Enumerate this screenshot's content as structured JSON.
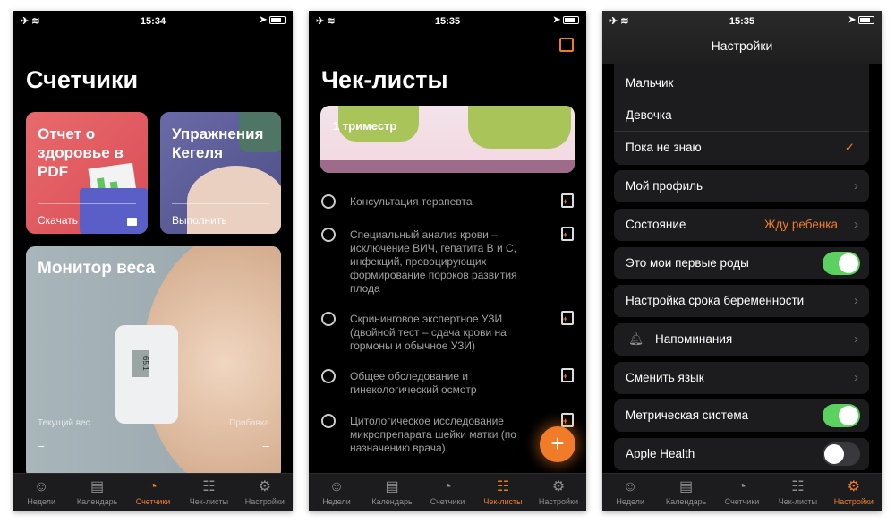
{
  "screens": [
    {
      "time": "15:34",
      "title": "Счетчики",
      "cards": {
        "pdf": {
          "title": "Отчет о здоровье в PDF",
          "action": "Скачать"
        },
        "kegel": {
          "title": "Упражнения Кегеля",
          "action": "Выполнить"
        },
        "weight": {
          "title": "Монитор веса",
          "current_label": "Текущий вес",
          "current_value": "–",
          "gain_label": "Прибавка",
          "gain_value": "–",
          "scale_reading": "65.1"
        }
      }
    },
    {
      "time": "15:35",
      "title": "Чек-листы",
      "banner": "1 триместр",
      "items": [
        "Консультация терапевта",
        "Специальный анализ крови – исключение ВИЧ, гепатита В и С, инфекций, провоцирующих формирование пороков развития плода",
        "Скрининговое экспертное УЗИ (двойной тест – сдача крови на гормоны и обычное УЗИ)",
        "Общее обследование и гинекологический осмотр",
        "Цитологическое исследование микропрепарата шейки матки (по назначению врача)"
      ],
      "fab": "+"
    },
    {
      "time": "15:35",
      "title": "Настройки",
      "gender_options": [
        "Мальчик",
        "Девочка",
        "Пока не знаю"
      ],
      "selected": "Пока не знаю",
      "rows": {
        "profile": "Мой профиль",
        "state": "Состояние",
        "state_value": "Жду ребенка",
        "first_birth": "Это мои первые роды",
        "pregnancy_term": "Настройка срока беременности",
        "reminders": "Напоминания",
        "language": "Сменить язык",
        "metric": "Метрическая система",
        "health": "Apple Health"
      },
      "toggles": {
        "first_birth": true,
        "metric": true,
        "health": false
      }
    }
  ],
  "tabs": [
    "Недели",
    "Календарь",
    "Счетчики",
    "Чек-листы",
    "Настройки"
  ],
  "tab_icons": [
    "baby-face-icon",
    "calendar-icon",
    "gauge-icon",
    "checklist-icon",
    "gear-icon"
  ],
  "colors": {
    "accent": "#f07c2a",
    "toggle_on": "#5bd15f",
    "pdf_card": "#e05a5e",
    "kegel_card": "#5e5f9e"
  }
}
